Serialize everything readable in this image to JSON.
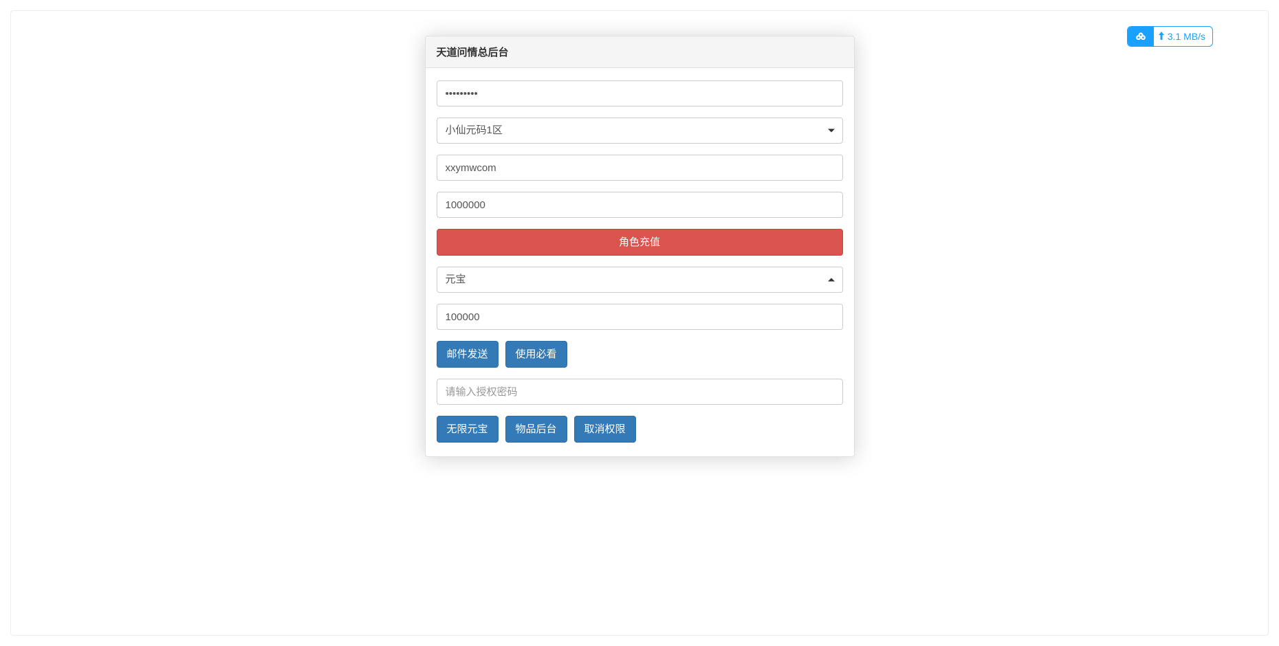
{
  "panel": {
    "title": "天道问情总后台",
    "password_value": "•••••••••",
    "server_select": "小仙元码1区",
    "account_value": "xxymwcom",
    "amount_value": "1000000",
    "recharge_button": "角色充值",
    "currency_select": "元宝",
    "mail_amount": "100000",
    "buttons_row1": {
      "send_mail": "邮件发送",
      "usage_guide": "使用必看"
    },
    "auth_placeholder": "请输入授权密码",
    "buttons_row2": {
      "unlimited_yuanbao": "无限元宝",
      "item_backend": "物品后台",
      "revoke_permission": "取消权限"
    }
  },
  "speed_widget": {
    "value": "3.1 MB/s"
  }
}
